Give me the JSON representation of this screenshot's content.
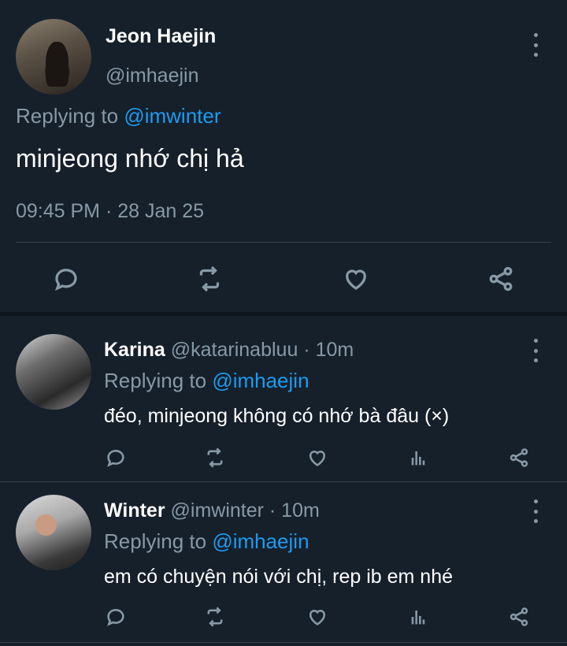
{
  "main_tweet": {
    "display_name": "Jeon Haejin",
    "handle": "@imhaejin",
    "replying_prefix": "Replying to ",
    "replying_to": "@imwinter",
    "text": "minjeong nhớ chị hả",
    "timestamp": "09:45 PM · 28 Jan 25"
  },
  "replies": [
    {
      "display_name": "Karina",
      "handle": "@katarinabluu",
      "time": " · 10m",
      "replying_prefix": "Replying to ",
      "replying_to": "@imhaejin",
      "text": "đéo, minjeong không có nhớ bà đâu (×)"
    },
    {
      "display_name": "Winter",
      "handle": "@imwinter",
      "time": " · 10m",
      "replying_prefix": "Replying to ",
      "replying_to": "@imhaejin",
      "text": "em có chuyện nói với chị, rep ib em nhé"
    }
  ],
  "icons": {
    "actions": [
      "reply-icon",
      "retweet-icon",
      "like-icon",
      "share-icon"
    ],
    "reply_actions": [
      "reply-icon",
      "retweet-icon",
      "like-icon",
      "analytics-icon",
      "share-icon"
    ],
    "more": "more-vertical-icon"
  },
  "colors": {
    "background": "#15202b",
    "link": "#1d9bf0",
    "muted": "#8899a6",
    "divider": "#38444d"
  }
}
